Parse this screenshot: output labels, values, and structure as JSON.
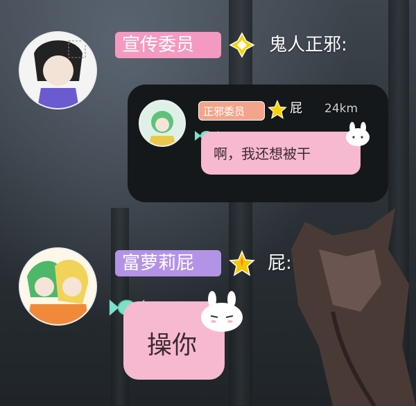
{
  "messages": [
    {
      "role_badge": "宣传委员",
      "badge_color": "#f49ac1",
      "sender": "鬼人正邪:",
      "star_color": "#f7d400",
      "quoted_card": {
        "badge": "正邪委员",
        "sender": "屁",
        "distance": "24km",
        "bubble_text": "啊，我还想被干"
      }
    },
    {
      "role_badge": "富萝莉屁",
      "badge_color": "#b393e6",
      "sender": "屁:",
      "star_color": "#f7c600",
      "bubble_text": "操你"
    }
  ]
}
